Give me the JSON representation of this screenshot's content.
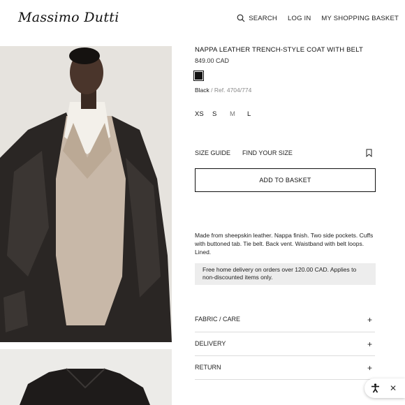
{
  "header": {
    "logo": "Massimo Dutti",
    "search_label": "SEARCH",
    "login_label": "LOG IN",
    "basket_label": "MY SHOPPING BASKET"
  },
  "product": {
    "title": "NAPPA LEATHER TRENCH-STYLE COAT WITH BELT",
    "price": "849.00 CAD",
    "swatch_color": "#111111",
    "color_name": "Black",
    "ref_separator": " / ",
    "ref": "Ref. 4704/774",
    "sizes": [
      "XS",
      "S",
      "M",
      "L"
    ],
    "size_guide": "SIZE GUIDE",
    "find_size": "FIND YOUR SIZE",
    "add_to_basket": "ADD TO BASKET",
    "description": "Made from sheepskin leather. Nappa finish. Two side pockets. Cuffs with buttoned tab. Tie belt. Back vent. Waistband with belt loops. Lined.",
    "delivery_note": "Free home delivery on orders over 120.00 CAD. Applies to non-discounted items only.",
    "accordion": [
      {
        "label": "FABRIC / CARE",
        "icon": "+"
      },
      {
        "label": "DELIVERY",
        "icon": "+"
      },
      {
        "label": "RETURN",
        "icon": "+"
      }
    ]
  },
  "widget": {
    "close": "✕"
  },
  "colors": {
    "accent": "#111111",
    "info_box": "#ededed"
  }
}
